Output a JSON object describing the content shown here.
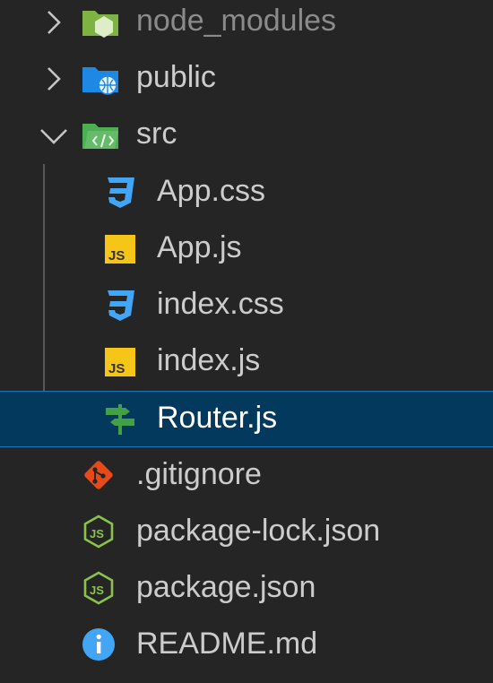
{
  "explorer": {
    "items": [
      {
        "label": "node_modules",
        "kind": "folder",
        "state": "collapsed",
        "icon": "node-folder-icon",
        "dimmed": true
      },
      {
        "label": "public",
        "kind": "folder",
        "state": "collapsed",
        "icon": "public-folder-icon"
      },
      {
        "label": "src",
        "kind": "folder",
        "state": "expanded",
        "icon": "src-folder-icon"
      },
      {
        "label": "App.css",
        "kind": "file",
        "icon": "css-icon"
      },
      {
        "label": "App.js",
        "kind": "file",
        "icon": "js-icon"
      },
      {
        "label": "index.css",
        "kind": "file",
        "icon": "css-icon"
      },
      {
        "label": "index.js",
        "kind": "file",
        "icon": "js-icon"
      },
      {
        "label": "Router.js",
        "kind": "file",
        "icon": "router-signpost-icon",
        "selected": true
      },
      {
        "label": ".gitignore",
        "kind": "file",
        "icon": "git-icon"
      },
      {
        "label": "package-lock.json",
        "kind": "file",
        "icon": "nodejs-icon"
      },
      {
        "label": "package.json",
        "kind": "file",
        "icon": "nodejs-icon"
      },
      {
        "label": "README.md",
        "kind": "file",
        "icon": "info-icon"
      }
    ]
  },
  "colors": {
    "background": "#252526",
    "selection": "#04395e",
    "selection_border": "#1177bb",
    "css_icon": "#42a5f5",
    "js_icon": "#f5c518",
    "node_green": "#8bc34a",
    "git_red": "#e64a19",
    "info_blue": "#42a5f5"
  }
}
